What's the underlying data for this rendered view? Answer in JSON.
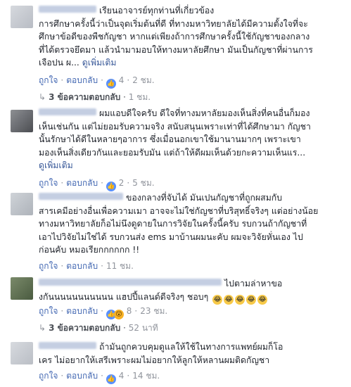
{
  "comments": [
    {
      "lines": [
        "เรียนอาจารย์ทุกท่านที่เกี่ยวข้อง",
        "การศึกษาครั้งนี้ว่าเป็นจุดเริ่มต้นที่ดี ที่ทางมหาวิทยาลัยได้มีความตั้งใจที่จะ",
        "ศึกษาข้อดีของพืชกัญชา หากแต่เพียงถ้าการศึกษาครั้งนี้ใช้กัญชาของกลาง",
        "ที่ได้ตรวจยึดมา แล้วนำมามอบให้ทางมหาลัยศึกษา มันเป็นกัญชาที่ผ่านการ",
        "เจือปน ผ..."
      ],
      "see_more": "ดูเพิ่มเติม",
      "like": "ถูกใจ",
      "reply": "ตอบกลับ",
      "reactions": "4",
      "time": "2 ชม.",
      "replies": "3 ข้อความตอบกลับ",
      "replies_time": "1 ชม."
    },
    {
      "lines": [
        "ผมแอบดีใจครับ ดีใจที่ทางมหาลัยมองเห็นสิ่งที่คนอื่นก็มอง",
        "เห็นเช่นกัน แต่ไม่ยอมรับความจริง สนับสนุนเพราะเท่าที่ได้ศึกษามา กัญชา",
        "นั้นรักษาได้ดีในหลายๆอาการ ซึ่งเมื่อนอกเขาใช้มานานมากๆ เพราะเขา",
        "มองเห็นสิ่งเดียวกันและยอมรับมัน แต่ถ้าให้ดีผมเห็นด้วยกะความเห็นแร..."
      ],
      "see_more": "ดูเพิ่มเติม",
      "like": "ถูกใจ",
      "reply": "ตอบกลับ",
      "reactions": "2",
      "time": "5 ชม."
    },
    {
      "lines": [
        "ของกลางที่จับได้ มันเปนกัญชาที่ถูกผสมกับ",
        "สารเคมีอย่างอื่นเพื่อความเมา อาจจะไม่ใช่กัญชาที่บริสุทธิ์จริงๆ แต่อย่างน้อย",
        "ทางมหาวิทยาลัยก็อไม่นึงดูดายในการวิจัยในครั้งนี้ครับ รบกวนถ้ากัญชาที่",
        "เอาไปวิจัยไม่ใช่ได้ รบกวนส่ง ems มาบ้านผมนะคับ ผมจะวิจัยหั่นเอง ไป",
        "ก่อนคับ หมอเรียกกกกกก !!"
      ],
      "like": "ถูกใจ",
      "reply": "ตอบกลับ",
      "time": "11 ชม."
    },
    {
      "lines": [
        "ไปตามล่าหาขอ",
        "งกันนนนนนนนนนน แฮปปี้แลนด์ดีจริงๆ ชอบๆ"
      ],
      "like": "ถูกใจ",
      "reply": "ตอบกลับ",
      "reactions": "8",
      "time": "23 ชม.",
      "replies": "3 ข้อความตอบกลับ",
      "replies_time": "52 นาที"
    },
    {
      "lines": [
        "ถ้ามันถูกควบคุมดูแลให้ใช้ในทางการแพทย์ผมก็โอ",
        "เคร ไม่อยากให้เสรีเพราะผมไม่อยากให้ลูกให้หลานผมติดกัญชา"
      ],
      "like": "ถูกใจ",
      "reply": "ตอบกลับ",
      "reactions": "4",
      "time": "14 ชม."
    }
  ]
}
